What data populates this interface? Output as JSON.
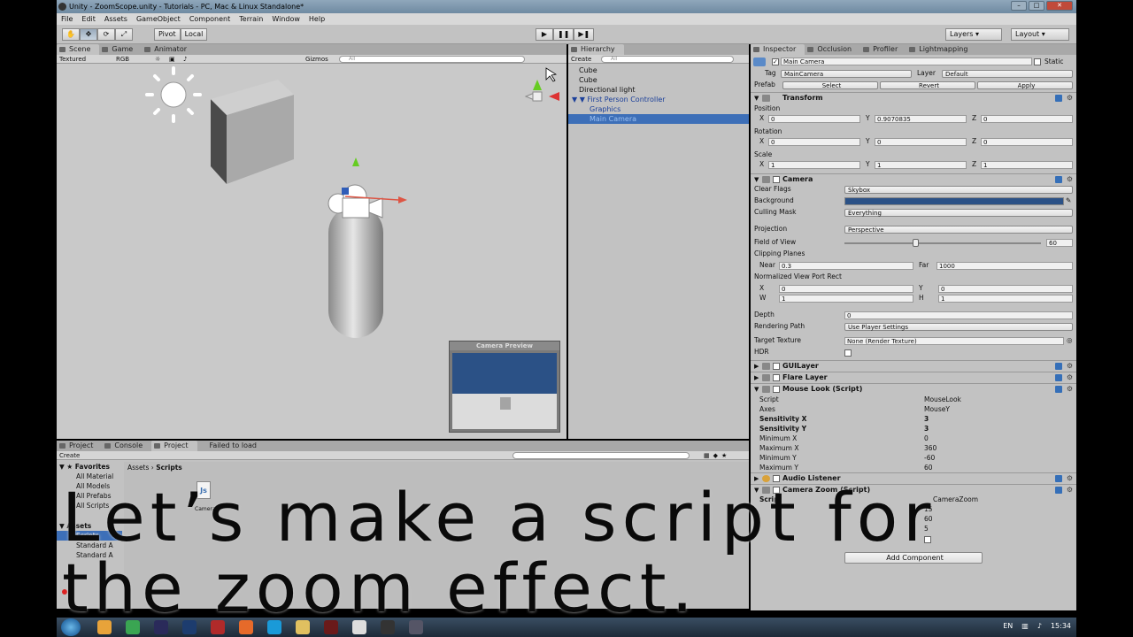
{
  "window": {
    "title": "Unity - ZoomScope.unity - Tutorials - PC, Mac & Linux Standalone*"
  },
  "menu": [
    "File",
    "Edit",
    "Assets",
    "GameObject",
    "Component",
    "Terrain",
    "Window",
    "Help"
  ],
  "toolbar": {
    "pivot": "Pivot",
    "local": "Local",
    "layers": "Layers",
    "layout": "Layout"
  },
  "scene": {
    "tabs": [
      "Scene",
      "Game",
      "Animator"
    ],
    "shading": "Textured",
    "render_mode": "RGB",
    "gizmos": "Gizmos",
    "search_placeholder": "All",
    "camera_preview_title": "Camera Preview"
  },
  "hierarchy": {
    "tab": "Hierarchy",
    "create": "Create",
    "search_placeholder": "All",
    "items": [
      {
        "label": "Cube",
        "indent": 0,
        "selected": false
      },
      {
        "label": "Cube",
        "indent": 0,
        "selected": false
      },
      {
        "label": "Directional light",
        "indent": 0,
        "selected": false
      },
      {
        "label": "First Person Controller",
        "indent": 0,
        "selected": false
      },
      {
        "label": "Graphics",
        "indent": 1,
        "selected": false
      },
      {
        "label": "Main Camera",
        "indent": 1,
        "selected": true
      }
    ]
  },
  "inspector": {
    "tabs": [
      "Inspector",
      "Occlusion",
      "Profiler",
      "Lightmapping"
    ],
    "object_name": "Main Camera",
    "static": "Static",
    "tag_label": "Tag",
    "tag": "MainCamera",
    "layer_label": "Layer",
    "layer": "Default",
    "prefab_label": "Prefab",
    "prefab_buttons": [
      "Select",
      "Revert",
      "Apply"
    ],
    "transform": {
      "title": "Transform",
      "position": {
        "label": "Position",
        "x": "0",
        "y": "0.9070835",
        "z": "0"
      },
      "rotation": {
        "label": "Rotation",
        "x": "0",
        "y": "0",
        "z": "0"
      },
      "scale": {
        "label": "Scale",
        "x": "1",
        "y": "1",
        "z": "1"
      }
    },
    "camera": {
      "title": "Camera",
      "clear_flags_label": "Clear Flags",
      "clear_flags": "Skybox",
      "background_label": "Background",
      "culling_label": "Culling Mask",
      "culling": "Everything",
      "projection_label": "Projection",
      "projection": "Perspective",
      "fov_label": "Field of View",
      "fov": "60",
      "fov_fraction": 0.36,
      "clipping_label": "Clipping Planes",
      "near_label": "Near",
      "near": "0.3",
      "far_label": "Far",
      "far": "1000",
      "viewport_label": "Normalized View Port Rect",
      "vx": "0",
      "vy": "0",
      "vw": "1",
      "vh": "1",
      "depth_label": "Depth",
      "depth": "0",
      "rendering_label": "Rendering Path",
      "rendering": "Use Player Settings",
      "target_label": "Target Texture",
      "target": "None (Render Texture)",
      "hdr_label": "HDR",
      "background_color": "#2b5186"
    },
    "gui_layer": "GUILayer",
    "flare_layer": "Flare Layer",
    "mouse_look": {
      "title": "Mouse Look (Script)",
      "rows": [
        {
          "label": "Script",
          "value": "MouseLook",
          "bold": false
        },
        {
          "label": "Axes",
          "value": "MouseY",
          "bold": false
        },
        {
          "label": "Sensitivity X",
          "value": "3",
          "bold": true
        },
        {
          "label": "Sensitivity Y",
          "value": "3",
          "bold": true
        },
        {
          "label": "Minimum X",
          "value": "0",
          "bold": false
        },
        {
          "label": "Maximum X",
          "value": "360",
          "bold": false
        },
        {
          "label": "Minimum Y",
          "value": "-60",
          "bold": false
        },
        {
          "label": "Maximum Y",
          "value": "60",
          "bold": false
        }
      ]
    },
    "audio_listener": "Audio Listener",
    "camera_zoom": {
      "title": "Camera Zoom (Script)",
      "script_label": "Script",
      "script": "CameraZoom",
      "zoom": "15",
      "default": "60",
      "smooth": "5"
    },
    "add_component": "Add Component"
  },
  "project": {
    "tabs": [
      "Project",
      "Console",
      "Project",
      "Failed to load"
    ],
    "create": "Create",
    "breadcrumb": [
      "Assets",
      "Scripts"
    ],
    "favorites_title": "Favorites",
    "favorites": [
      "All Material",
      "All Models",
      "All Prefabs",
      "All Scripts"
    ],
    "assets_title": "Assets",
    "asset_items": [
      "Scripts",
      "Standard A",
      "Standard A"
    ],
    "file_label": "Camera"
  },
  "caption": "Let’s make a script for\nthe zoom effect.",
  "taskbar": {
    "lang": "EN",
    "clock": "15:34"
  }
}
